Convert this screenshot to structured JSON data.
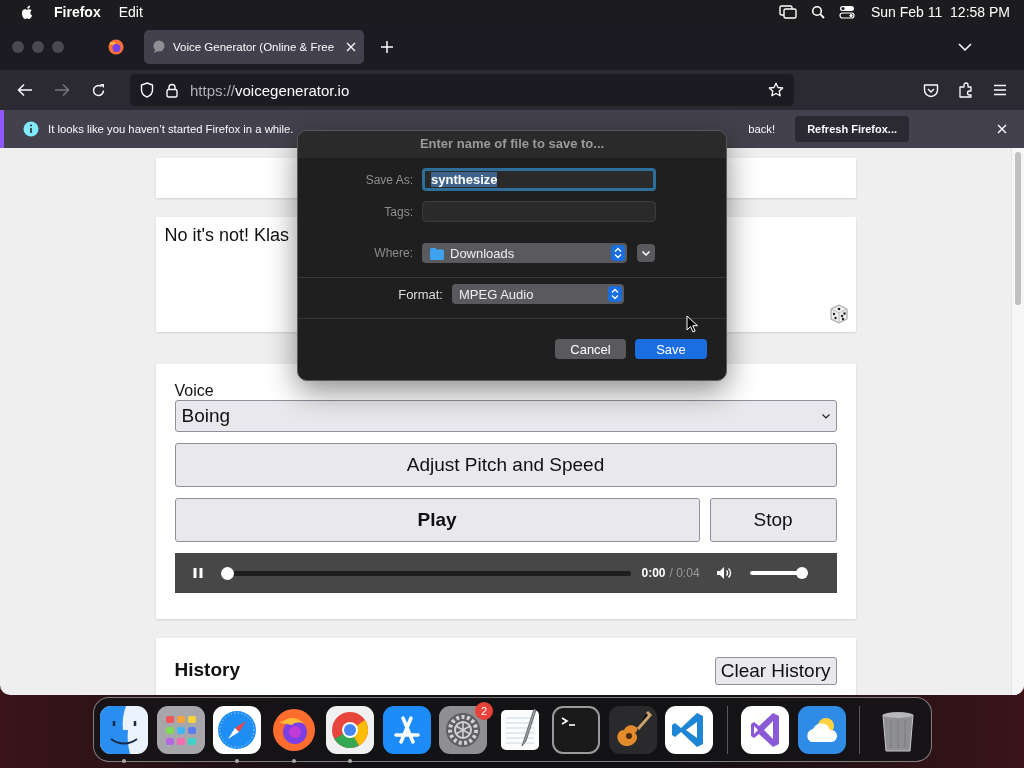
{
  "menu_bar": {
    "app": "Firefox",
    "menus": [
      "Edit"
    ],
    "clock": "Sun Feb 11  12:58 PM"
  },
  "tabs": [
    {
      "title": "Voice Generator (Online & Free",
      "selected": true
    }
  ],
  "toolbar": {
    "forward_enabled": false,
    "url_scheme": "https://",
    "url_host": "voicegenerator.io"
  },
  "notification": {
    "message": "It looks like you haven’t started Firefox in a while.",
    "message_end": "back!",
    "button": "Refresh Firefox..."
  },
  "page": {
    "text_input": "No it's not! Klas",
    "voice_label": "Voice",
    "voice": "Boing",
    "adjust_button": "Adjust Pitch and Speed",
    "play_button": "Play",
    "stop_button": "Stop",
    "player": {
      "playing": true,
      "current": "0:00",
      "duration": "/ 0:04",
      "level": 0,
      "volume": {
        "level": 1
      }
    },
    "history_title": "History",
    "clear_button": "Clear History"
  },
  "dialog": {
    "title": "Enter name of file to save to...",
    "save_as_label": "Save As:",
    "save_as_value": "synthesize",
    "tags_label": "Tags:",
    "where_label": "Where:",
    "where_value": "Downloads",
    "format_label": "Format:",
    "format_value": "MPEG Audio",
    "buttons": [
      {
        "label": "Cancel",
        "kind": "secondary"
      },
      {
        "label": "Save",
        "kind": "primary"
      }
    ]
  },
  "dock": [
    {
      "kind": "finder",
      "running": true
    },
    {
      "kind": "launchpad",
      "running": false
    },
    {
      "kind": "safari",
      "running": true
    },
    {
      "kind": "firefox",
      "running": true
    },
    {
      "kind": "chrome",
      "running": true
    },
    {
      "kind": "appstore",
      "running": false
    },
    {
      "kind": "settings",
      "running": false,
      "badge": "2"
    },
    {
      "kind": "textedit",
      "running": false
    },
    {
      "kind": "terminal",
      "running": false
    },
    {
      "kind": "garageband",
      "running": false
    },
    {
      "kind": "vscode",
      "running": false
    },
    {
      "kind": "separator"
    },
    {
      "kind": "visualstudio",
      "running": false
    },
    {
      "kind": "weather",
      "running": false
    },
    {
      "kind": "separator"
    },
    {
      "kind": "trash",
      "running": false
    }
  ]
}
